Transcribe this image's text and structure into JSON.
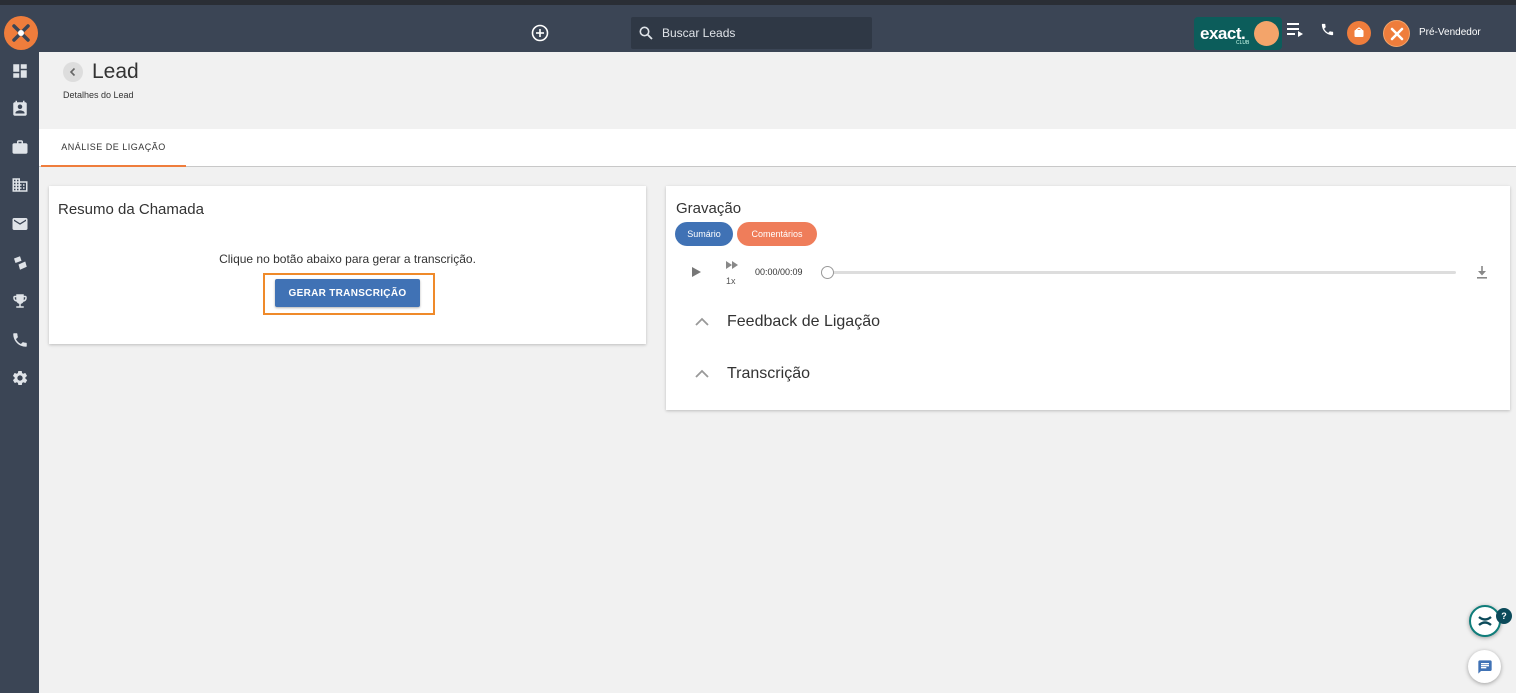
{
  "header": {
    "search_placeholder": "Buscar Leads",
    "exact_brand": "exact.",
    "exact_sub": "CLUB",
    "user_name": "Pré-Vendedor",
    "accent_color": "#ef7d3c",
    "bar_color": "#3b4555"
  },
  "sidebar": {
    "items": [
      {
        "icon": "dashboard-icon"
      },
      {
        "icon": "contacts-icon"
      },
      {
        "icon": "briefcase-icon"
      },
      {
        "icon": "building-icon"
      },
      {
        "icon": "mail-icon"
      },
      {
        "icon": "tags-icon"
      },
      {
        "icon": "trophy-icon"
      },
      {
        "icon": "phone-icon"
      },
      {
        "icon": "settings-icon"
      }
    ]
  },
  "page": {
    "title": "Lead",
    "subtitle": "Detalhes do Lead"
  },
  "tabs": [
    {
      "label": "ANÁLISE DE LIGAÇÃO",
      "active": true
    }
  ],
  "summary_card": {
    "title": "Resumo da Chamada",
    "hint": "Clique no botão abaixo para gerar a transcrição.",
    "button": "GERAR TRANSCRIÇÃO"
  },
  "recording_card": {
    "title": "Gravação",
    "chips": [
      "Sumário",
      "Comentários"
    ],
    "speed": "1x",
    "time": "00:00/00:09",
    "progress": 0,
    "sections": [
      "Feedback de Ligação",
      "Transcrição"
    ]
  },
  "help_badge": "?"
}
